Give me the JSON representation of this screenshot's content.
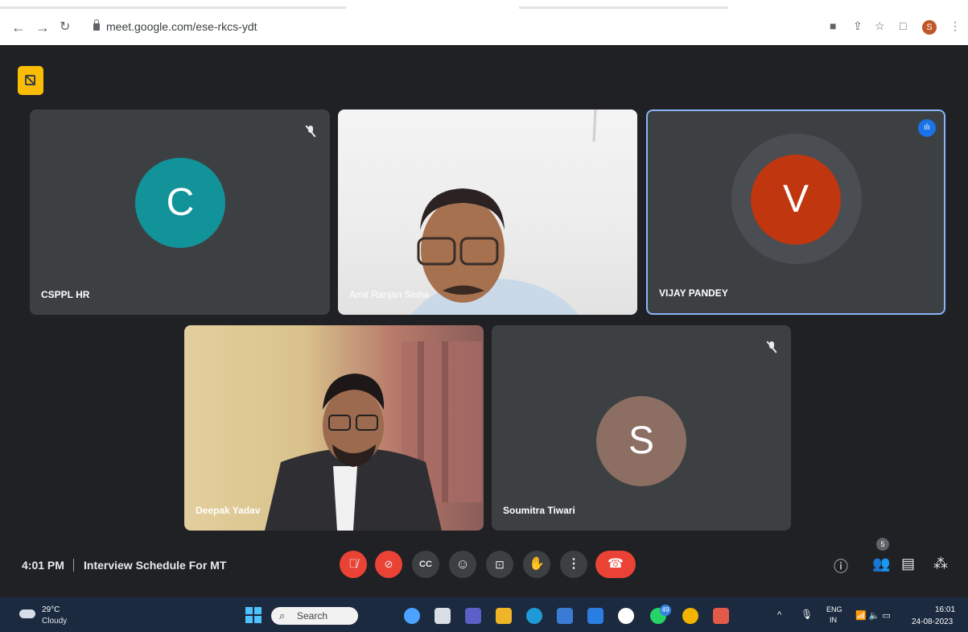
{
  "browser": {
    "url": "meet.google.com/ese-rkcs-ydt",
    "profile_initial": "S"
  },
  "participants": [
    {
      "name": "CSPPL HR",
      "initial": "C",
      "color": "#12939a",
      "muted": true,
      "video": false
    },
    {
      "name": "Amit Ranjan Sinha",
      "initial": "",
      "muted": false,
      "video": true
    },
    {
      "name": "VIJAY PANDEY",
      "initial": "V",
      "color": "#c0360f",
      "speaking": true,
      "video": false
    },
    {
      "name": "Deepak Yadav",
      "initial": "",
      "muted": false,
      "video": true
    },
    {
      "name": "Soumitra Tiwari",
      "initial": "S",
      "color": "#8d6e63",
      "muted": true,
      "video": false
    }
  ],
  "meeting": {
    "time": "4:01 PM",
    "title": "Interview Schedule For MT",
    "participant_count": "5"
  },
  "controls": [
    {
      "name": "microphone",
      "state": "off"
    },
    {
      "name": "camera",
      "state": "off"
    },
    {
      "name": "captions"
    },
    {
      "name": "reactions"
    },
    {
      "name": "present"
    },
    {
      "name": "raise-hand"
    },
    {
      "name": "more-options"
    },
    {
      "name": "leave-call"
    }
  ],
  "taskbar": {
    "temperature": "29°C",
    "weather": "Cloudy",
    "search_placeholder": "Search",
    "notification_badge": "49",
    "lang_primary": "ENG",
    "lang_secondary": "IN",
    "clock_time": "16:01",
    "clock_date": "24-08-2023"
  },
  "colors": {
    "meet_bg": "#202124",
    "tile_bg": "#3c4043",
    "danger": "#ea4335",
    "active_border": "#8ab4f8",
    "rec_badge": "#fbbc04"
  }
}
